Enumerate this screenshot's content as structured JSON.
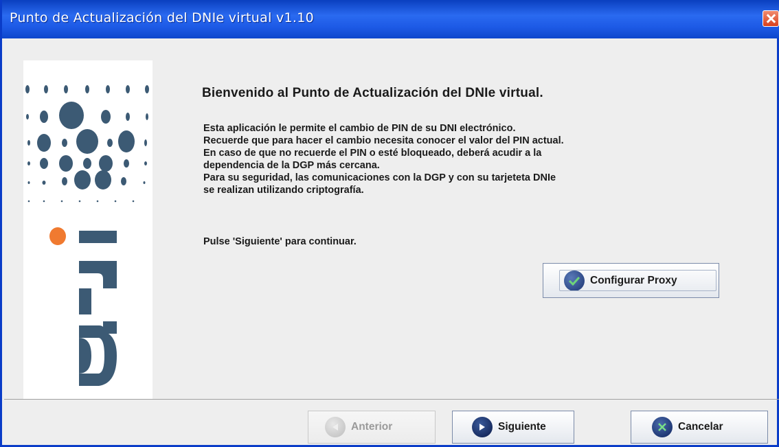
{
  "window": {
    "title": "Punto de Actualización del DNIe virtual v1.10"
  },
  "logo": {
    "text": "dni",
    "brand_color": "#3c5a74",
    "accent_color": "#f07a30"
  },
  "content": {
    "welcome_title": "Bienvenido al Punto de Actualización del DNIe virtual.",
    "description_lines": [
      "Esta aplicación le permite el cambio de PIN de su DNI electrónico.",
      "Recuerde que para hacer el cambio necesita conocer el valor del PIN actual.",
      "En caso de que no recuerde el PIN o esté bloqueado, deberá acudir a la",
      "dependencia de la DGP más cercana.",
      "Para su seguridad, las comunicaciones con la DGP y con su tarjeteta DNIe",
      "se realizan utilizando criptografía."
    ],
    "press_text": "Pulse 'Siguiente' para continuar.",
    "proxy_button": {
      "label": "Configurar Proxy",
      "icon": "check-icon"
    }
  },
  "footer": {
    "back_button": {
      "label": "Anterior",
      "icon": "arrow-left-icon",
      "enabled": false
    },
    "next_button": {
      "label": "Siguiente",
      "icon": "arrow-right-icon"
    },
    "cancel_button": {
      "label": "Cancelar",
      "icon": "x-icon"
    }
  }
}
